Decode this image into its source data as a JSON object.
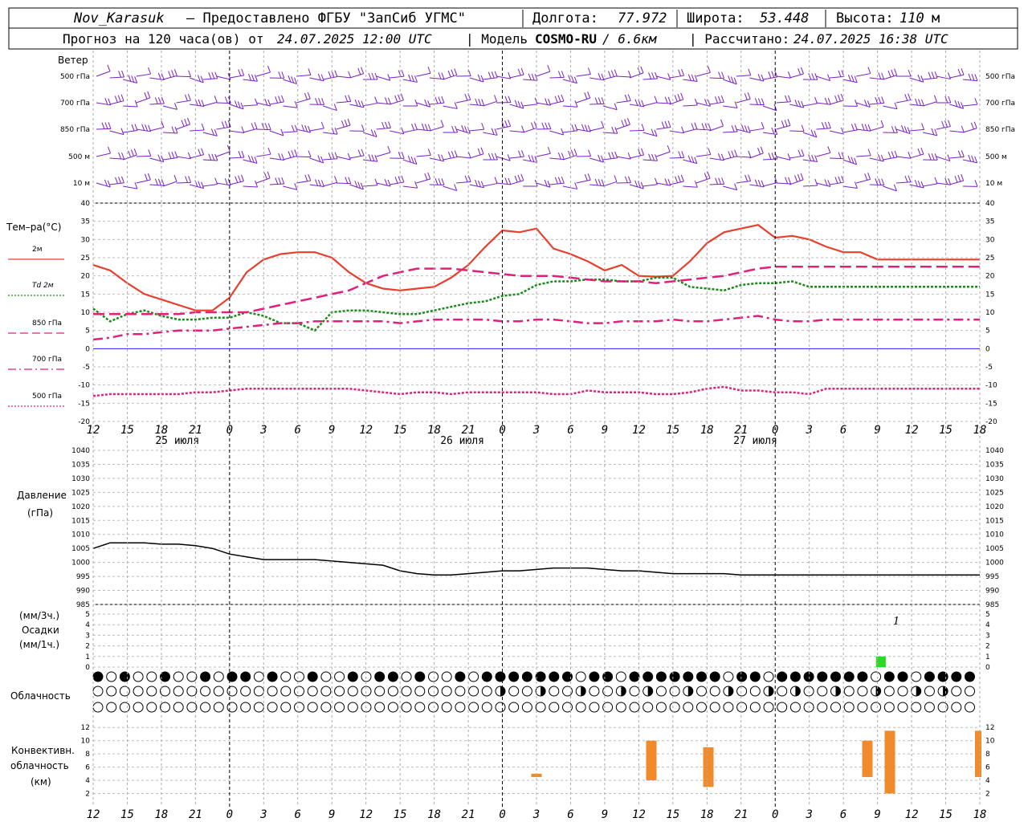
{
  "header": {
    "station": "Nov_Karasuk",
    "provider": "– Предоставлено ФГБУ \"ЗапСиб УГМС\"",
    "lon_label": "Долгота:",
    "lon_value": "77.972",
    "lat_label": "Широта:",
    "lat_value": "53.448",
    "alt_label": "Высота:",
    "alt_value": "110",
    "alt_unit": "м",
    "forecast_prefix": "Прогноз на 120 часа(ов) от",
    "forecast_time": "24.07.2025 12:00 UTC",
    "model_prefix": "| Модель",
    "model_name": "COSMO-RU",
    "model_res": "/ 6.6км",
    "calc_prefix": "| Рассчитано:",
    "calc_time": "24.07.2025 16:38 UTC"
  },
  "colors": {
    "wind": "#7a1fc9",
    "t2m": "#e8402c",
    "td2m": "#1a8a1a",
    "t850": "#e0207a",
    "t700": "#e0207a",
    "t500": "#e0207a",
    "precip": "#22dd22",
    "conv": "#f08a2a",
    "zero": "#2020ff"
  },
  "wind_panel": {
    "title": "Ветер",
    "levels": [
      "500 гПа",
      "700 гПа",
      "850 гПа",
      "500 м",
      "10 м"
    ]
  },
  "temp_panel": {
    "title": "Тем–ра(°С)",
    "legend": [
      {
        "label": "2м",
        "key": "t2m",
        "style": "solid"
      },
      {
        "label": "Td 2м",
        "key": "td2m",
        "style": "dot"
      },
      {
        "label": "850 гПа",
        "key": "t850",
        "style": "dash"
      },
      {
        "label": "700 гПа",
        "key": "t700",
        "style": "dashdot"
      },
      {
        "label": "500 гПа",
        "key": "t500",
        "style": "dot"
      }
    ],
    "ticks": [
      "40",
      "35",
      "30",
      "25",
      "20",
      "15",
      "10",
      "5",
      "0",
      "-5",
      "-10",
      "-15",
      "-20"
    ]
  },
  "pressure_panel": {
    "title": "Давление",
    "unit": "(гПа)",
    "ticks": [
      "1040",
      "1035",
      "1030",
      "1025",
      "1020",
      "1015",
      "1010",
      "1005",
      "1000",
      "995",
      "990",
      "985"
    ]
  },
  "precip_panel": {
    "title_unit3": "(мм/3ч.)",
    "title": "Осадки",
    "title_unit1": "(мм/1ч.)",
    "ticks": [
      "5",
      "4",
      "3",
      "2",
      "1",
      "0"
    ],
    "annotation": "1"
  },
  "cloud_panel": {
    "title": "Облачность"
  },
  "conv_panel": {
    "title1": "Конвективн.",
    "title2": "облачность",
    "title3": "(км)",
    "ticks": [
      "12",
      "10",
      "8",
      "6",
      "4",
      "2"
    ]
  },
  "x_ticks": [
    "12",
    "15",
    "18",
    "21",
    "0",
    "3",
    "6",
    "9",
    "12",
    "15",
    "18",
    "21",
    "0",
    "3",
    "6",
    "9",
    "12",
    "15",
    "18",
    "21",
    "0",
    "3",
    "6",
    "9",
    "12",
    "15",
    "18"
  ],
  "day_labels": [
    "25 июля",
    "26 июля",
    "27 июля"
  ],
  "chart_data": [
    {
      "type": "line",
      "title": "Тем–ра(°С)",
      "x_hours": [
        0,
        3,
        6,
        9,
        12,
        15,
        18,
        21,
        24,
        27,
        30,
        33,
        36,
        39,
        42,
        45,
        48,
        51,
        54,
        57,
        60,
        63,
        66,
        69,
        72,
        75,
        78,
        81,
        84,
        87,
        90,
        93,
        96,
        99,
        102,
        105,
        108,
        111,
        114,
        117,
        120,
        123,
        126,
        129,
        132,
        135,
        138,
        141,
        144,
        147,
        150,
        153,
        156
      ],
      "ylim": [
        -20,
        40
      ],
      "series": [
        {
          "name": "2м",
          "values": [
            23,
            21.5,
            18,
            15,
            13.5,
            12,
            10.5,
            10.5,
            14,
            21,
            24.5,
            26,
            26.5,
            26.5,
            25,
            21,
            18,
            16.5,
            16,
            16.5,
            17,
            19.5,
            23,
            28,
            32.5,
            32,
            33,
            27.5,
            26,
            24,
            21.5,
            23,
            20,
            19.8,
            20,
            24,
            29,
            32,
            33,
            34,
            30.5,
            31,
            30,
            28,
            26.5,
            26.5,
            24.5,
            24.5,
            24.5,
            24.5,
            24.5,
            24.5,
            24.5
          ]
        },
        {
          "name": "Td 2м",
          "values": [
            11,
            7.5,
            9.5,
            10.5,
            9,
            8,
            8,
            8.5,
            8.5,
            10,
            9,
            7,
            7,
            5,
            10,
            10.5,
            10.5,
            10,
            9.5,
            9.5,
            10.5,
            11.5,
            12.5,
            13,
            14.5,
            15,
            17.5,
            18.5,
            18.5,
            19,
            19,
            18.5,
            18.5,
            19.5,
            19.5,
            17,
            16.5,
            16,
            17.5,
            18,
            18,
            18.5,
            17,
            17,
            17,
            17,
            17,
            17,
            17,
            17,
            17,
            17,
            17
          ]
        },
        {
          "name": "850 гПа",
          "values": [
            9.5,
            9.5,
            9.5,
            9.5,
            9.5,
            9.5,
            10,
            10,
            10,
            10,
            11,
            12,
            13,
            14,
            15,
            16,
            18,
            20,
            21,
            22,
            22,
            22,
            21.5,
            21,
            20.5,
            20,
            20,
            20,
            19.5,
            19,
            18.5,
            18.5,
            18.5,
            18,
            18.5,
            19,
            19.5,
            20,
            21,
            22,
            22.5,
            22.5,
            22.5,
            22.5,
            22.5,
            22.5,
            22.5,
            22.5,
            22.5,
            22.5,
            22.5,
            22.5,
            22.5
          ]
        },
        {
          "name": "700 гПа",
          "values": [
            2.5,
            3,
            4,
            4,
            4.5,
            5,
            5,
            5,
            5.5,
            6,
            6.5,
            7,
            7,
            7.5,
            7.5,
            7.5,
            7.5,
            7.5,
            7,
            7.5,
            8,
            8,
            8,
            8,
            7.5,
            7.5,
            8,
            8,
            7.5,
            7,
            7,
            7.5,
            7.5,
            7.5,
            8,
            7.5,
            7.5,
            8,
            8.5,
            9,
            8,
            7.5,
            7.5,
            8,
            8,
            8,
            8,
            8,
            8,
            8,
            8,
            8,
            8
          ]
        },
        {
          "name": "500 гПа",
          "values": [
            -13,
            -12.5,
            -12.5,
            -12.5,
            -12.5,
            -12.5,
            -12,
            -12,
            -11.5,
            -11,
            -11,
            -11,
            -11,
            -11,
            -11,
            -11,
            -11.5,
            -12,
            -12.5,
            -12,
            -12,
            -12.5,
            -12,
            -12,
            -12,
            -12,
            -12,
            -12.5,
            -12.5,
            -11.5,
            -12,
            -12,
            -12,
            -12.5,
            -12.5,
            -12,
            -11,
            -10.5,
            -11.5,
            -11.5,
            -12,
            -12,
            -12.5,
            -11,
            -11,
            -11,
            -11,
            -11,
            -11,
            -11,
            -11,
            -11,
            -11
          ]
        }
      ]
    },
    {
      "type": "line",
      "title": "Давление",
      "ylim": [
        985,
        1040
      ],
      "series": [
        {
          "name": "Давление",
          "values": [
            1005,
            1007,
            1007,
            1007,
            1006.5,
            1006.5,
            1006,
            1005,
            1003,
            1002,
            1001,
            1001,
            1001,
            1001,
            1000.5,
            1000,
            999.5,
            999,
            997,
            996,
            995.5,
            995.5,
            996,
            996.5,
            997,
            997,
            997.5,
            998,
            998,
            998,
            997.5,
            997,
            997,
            996.5,
            996,
            996,
            996,
            996,
            995.5,
            995.5,
            995.5,
            995.5,
            995.5,
            995.5,
            995.5,
            995.5,
            995.5,
            995.5,
            995.5,
            995.5,
            995.5,
            995.5,
            995.5
          ]
        }
      ]
    },
    {
      "type": "bar",
      "title": "Осадки",
      "ylim": [
        0,
        5
      ],
      "bars": [
        {
          "x_hour": 110,
          "value": 1
        }
      ]
    },
    {
      "type": "bar",
      "title": "Конвективн. облачность",
      "ylim": [
        0,
        13
      ],
      "bars": [
        {
          "x_hour": 63,
          "bottom": 4.5,
          "top": 5
        },
        {
          "x_hour": 81,
          "bottom": 4,
          "top": 10
        },
        {
          "x_hour": 90,
          "bottom": 3,
          "top": 9
        },
        {
          "x_hour": 114,
          "bottom": 4.5,
          "top": 10
        },
        {
          "x_hour": 117,
          "bottom": 2,
          "top": 11.5
        },
        {
          "x_hour": 126,
          "bottom": 4.5,
          "top": 11.5
        }
      ]
    }
  ]
}
